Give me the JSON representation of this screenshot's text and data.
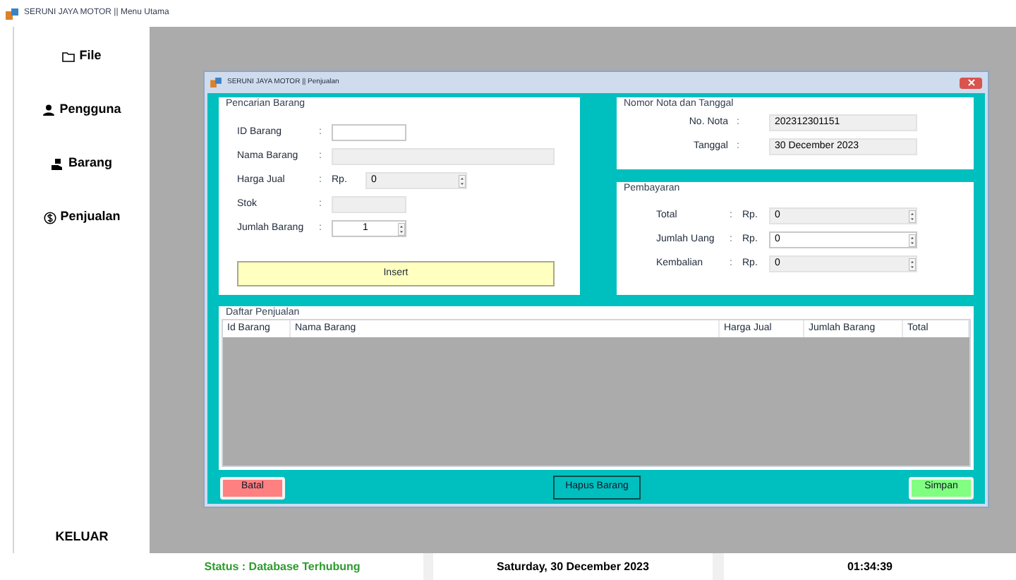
{
  "window": {
    "title": "SERUNI JAYA MOTOR || Menu Utama"
  },
  "sidebar": {
    "items": [
      {
        "label": "File"
      },
      {
        "label": "Pengguna"
      },
      {
        "label": "Barang"
      },
      {
        "label": "Penjualan"
      }
    ],
    "exit": "KELUAR"
  },
  "child_window": {
    "title": "SERUNI JAYA MOTOR || Penjualan",
    "search_group": {
      "title": "Pencarian Barang",
      "fields": [
        {
          "label": "ID Barang",
          "colon": ":",
          "kind": "text",
          "disabled": false
        },
        {
          "label": "Nama Barang",
          "colon": ":",
          "kind": "wide",
          "disabled": true
        },
        {
          "label": "Harga Jual",
          "colon": ":",
          "kind": "currency",
          "prefix": "Rp.",
          "value": "0",
          "disabled": true
        },
        {
          "label": "Stok",
          "colon": ":",
          "kind": "text",
          "disabled": true
        },
        {
          "label": "Jumlah Barang",
          "colon": ":",
          "kind": "spinner",
          "value": "1",
          "disabled": false
        }
      ],
      "button": "Insert"
    },
    "nota_group": {
      "title": "Nomor Nota dan Tanggal",
      "fields": [
        {
          "label": "No. Nota",
          "colon": ":",
          "value": "202312301151"
        },
        {
          "label": "Tanggal",
          "colon": ":",
          "value": "30 December 2023"
        }
      ]
    },
    "payment_group": {
      "title": "Pembayaran",
      "fields": [
        {
          "label": "Total",
          "colon": ":",
          "prefix": "Rp.",
          "value": "0",
          "disabled": true
        },
        {
          "label": "Jumlah Uang",
          "colon": ":",
          "prefix": "Rp.",
          "value": "0",
          "disabled": false
        },
        {
          "label": "Kembalian",
          "colon": ":",
          "prefix": "Rp.",
          "value": "0",
          "disabled": true
        }
      ]
    },
    "sales_table": {
      "title": "Daftar Penjualan",
      "columns": [
        "Id Barang",
        "Nama Barang",
        "Harga Jual",
        "Jumlah Barang",
        "Total"
      ]
    },
    "buttons": [
      {
        "label": "Batal",
        "kind": "danger"
      },
      {
        "label": "Hapus Barang",
        "kind": "outline"
      },
      {
        "label": "Simpan",
        "kind": "success"
      }
    ]
  },
  "status_bar": {
    "status": "Status : Database Terhubung",
    "date": "Saturday, 30 December 2023",
    "time": "01:34:39"
  }
}
